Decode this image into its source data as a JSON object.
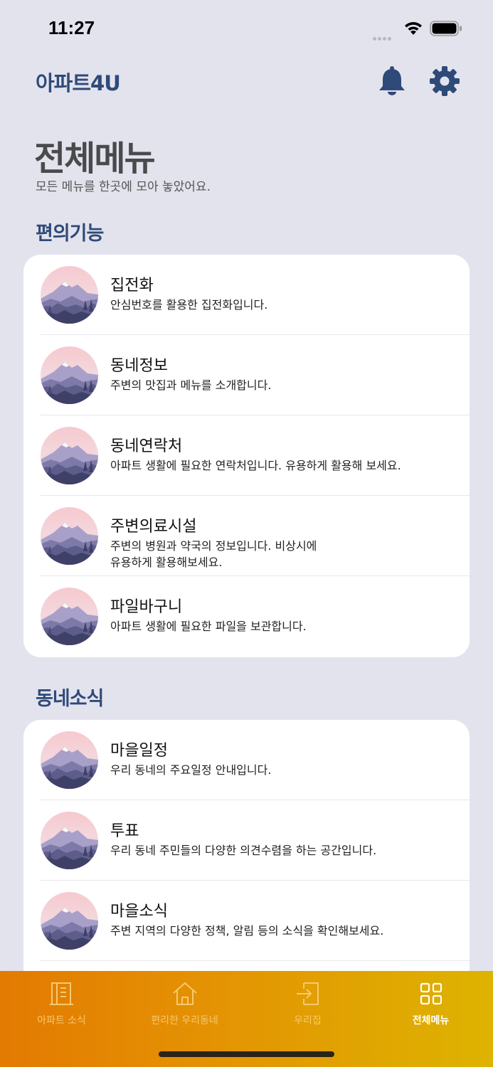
{
  "status": {
    "time": "11:27"
  },
  "header": {
    "logo": "아파트4U"
  },
  "page": {
    "title": "전체메뉴",
    "subtitle": "모든 메뉴를 한곳에 모아 놓았어요."
  },
  "sections": [
    {
      "title": "편의기능",
      "items": [
        {
          "title": "집전화",
          "desc": "안심번호를 활용한 집전화입니다."
        },
        {
          "title": "동네정보",
          "desc": "주변의 맛집과 메뉴를 소개합니다."
        },
        {
          "title": "동네연락처",
          "desc": "아파트 생활에 필요한 연락처입니다. 유용하게 활용해 보세요."
        },
        {
          "title": "주변의료시설",
          "desc": "주변의 병원과 약국의 정보입니다. 비상시에\n유용하게 활용해보세요."
        },
        {
          "title": "파일바구니",
          "desc": "아파트 생활에 필요한 파일을 보관합니다."
        }
      ]
    },
    {
      "title": "동네소식",
      "items": [
        {
          "title": "마을일정",
          "desc": "우리 동네의 주요일정 안내입니다."
        },
        {
          "title": "투표",
          "desc": "우리 동네 주민들의 다양한 의견수렴을 하는 공간입니다."
        },
        {
          "title": "마을소식",
          "desc": "주변 지역의 다양한 정책, 알림 등의 소식을 확인해보세요."
        }
      ]
    }
  ],
  "tabs": [
    {
      "label": "아파트 소식",
      "icon": "building-icon",
      "active": false
    },
    {
      "label": "편리한 우리동네",
      "icon": "home-icon",
      "active": false
    },
    {
      "label": "우리집",
      "icon": "login-door-icon",
      "active": false
    },
    {
      "label": "전체메뉴",
      "icon": "grid-icon",
      "active": true
    }
  ],
  "colors": {
    "brand": "#2f4a78",
    "background": "#e3e3ee",
    "tabbar_start": "#e37a02",
    "tabbar_end": "#ddb300"
  }
}
